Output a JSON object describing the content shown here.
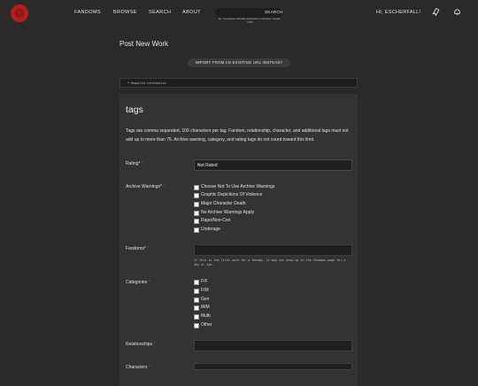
{
  "header": {
    "nav": [
      "FANDOMS",
      "BROWSE",
      "SEARCH",
      "ABOUT"
    ],
    "search_button": "SEARCH",
    "search_tip": "tip: \"sometime rebuilds (coloration) collection\" length:<100",
    "greeting": "HI, ESCHERFALL!"
  },
  "page": {
    "title": "Post New Work",
    "import_button": "IMPORT FROM AN EXISTING URL INSTEAD?",
    "required_notice": "* Required information"
  },
  "tags": {
    "title": "tags",
    "description": "Tags are comma separated, 100 characters per tag. Fandom, relationship, character, and additional tags must not add up to more than 75. Archive warning, category, and rating tags do not count toward this limit.",
    "rating_label": "Rating*",
    "rating_value": "Not Rated",
    "warnings_label": "Archive Warnings*",
    "warnings": [
      "Choose Not To Use Archive Warnings",
      "Graphic Depictions Of Violence",
      "Major Character Death",
      "No Archive Warnings Apply",
      "Rape/Non-Con",
      "Underage"
    ],
    "fandoms_label": "Fandoms*",
    "fandoms_hint": "If this is the first work for a fandom, it may not show up in the fandoms page for a day or two.",
    "categories_label": "Categories",
    "categories": [
      "F/F",
      "F/M",
      "Gen",
      "M/M",
      "Multi",
      "Other"
    ],
    "relationships_label": "Relationships",
    "characters_label": "Characters"
  },
  "colors": {
    "background": "#2a2a2a",
    "panel": "#333333",
    "required": "#c0392b",
    "logo": "#b91c1c"
  },
  "icons": [
    "ao3-logo-icon",
    "bookmark-icon",
    "bell-icon"
  ]
}
